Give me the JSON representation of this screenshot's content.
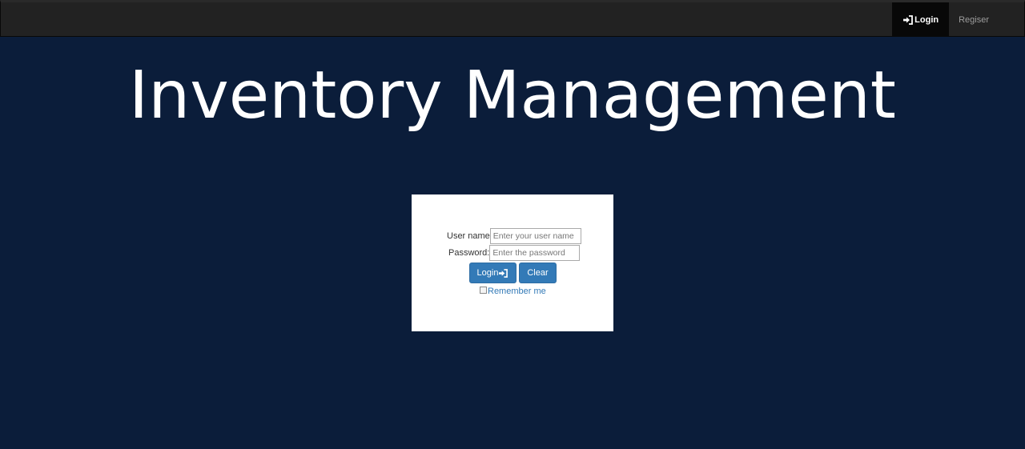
{
  "navbar": {
    "items": [
      {
        "label": "Login",
        "icon": "login-icon",
        "active": true
      },
      {
        "label": "Regiser",
        "active": false
      }
    ]
  },
  "hero": {
    "title": "Inventory Management"
  },
  "login_form": {
    "username_label": "User name",
    "username_placeholder": "Enter your user name",
    "username_value": "",
    "password_label": "Password:",
    "password_placeholder": "Enter the password",
    "password_value": "",
    "login_button_label": "Login",
    "login_button_icon": "login-icon",
    "clear_button_label": "Clear",
    "remember_label": "Remember me",
    "remember_checked": false
  },
  "colors": {
    "page_background": "#0b1d3a",
    "navbar_background": "#222222",
    "navbar_active_background": "#080808",
    "button_primary": "#337ab7",
    "link_color": "#337ab7"
  }
}
